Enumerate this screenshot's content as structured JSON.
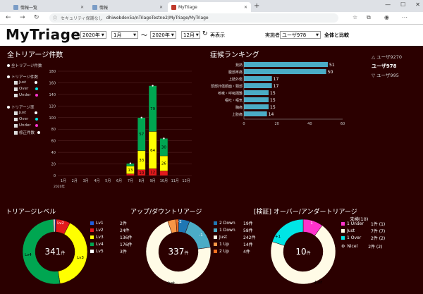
{
  "browser": {
    "tabs": [
      {
        "label": "情報一覧"
      },
      {
        "label": "情報"
      },
      {
        "label": "MyTriage"
      }
    ],
    "new_tab": "+",
    "window_buttons": [
      "—",
      "☐",
      "✕"
    ],
    "url_warning": "セキュリティ保護なし",
    "url_domain": "dhiwebdev5a/nTriageTestne2/MyTriage/MyTriage"
  },
  "header": {
    "title": "MyTriage",
    "from_year": "2020年",
    "from_month": "1月",
    "range_sep": "～",
    "to_year": "2020年",
    "to_month": "12月",
    "refresh_label": "再表示",
    "executor_label": "実施者",
    "executor_value": "ユーザ978",
    "compare_label": "全体と比較"
  },
  "triage_count": {
    "title": "全トリアージ件数",
    "legend": {
      "all": "全トリアージ件数",
      "group1": "トリアージ件数",
      "group1_items": [
        "Just",
        "Over",
        "Under"
      ],
      "group2": "トリアージ率",
      "group2_items": [
        "Just",
        "Over",
        "Under",
        "修正件数"
      ]
    },
    "y_ticks": [
      "180",
      "160",
      "140",
      "120",
      "100",
      "80",
      "60",
      "40",
      "20",
      "0"
    ],
    "x_labels": [
      "1月",
      "2月",
      "3月",
      "4月",
      "5月",
      "6月",
      "7月",
      "8月",
      "9月",
      "10月",
      "11月",
      "12月"
    ],
    "x_year": "2020年"
  },
  "chart_data": {
    "type": "bar",
    "categories": [
      "1月",
      "2月",
      "3月",
      "4月",
      "5月",
      "6月",
      "7月",
      "8月",
      "9月",
      "10月",
      "11月",
      "12月"
    ],
    "ylim": [
      0,
      180
    ],
    "series": [
      {
        "name": "Lv5",
        "color": "#ffffff",
        "values": [
          0,
          0,
          0,
          0,
          0,
          0,
          0,
          0,
          0,
          0,
          0,
          0
        ]
      },
      {
        "name": "Lv4",
        "color": "#00a651",
        "values": [
          0,
          0,
          0,
          0,
          0,
          0,
          5,
          57,
          79,
          30,
          0,
          0
        ]
      },
      {
        "name": "Lv3",
        "color": "#ffff00",
        "values": [
          0,
          0,
          0,
          0,
          0,
          0,
          13,
          33,
          64,
          26,
          0,
          0
        ]
      },
      {
        "name": "Lv2",
        "color": "#e31a1c",
        "values": [
          0,
          0,
          0,
          0,
          0,
          0,
          3,
          10,
          12,
          8,
          0,
          0
        ]
      }
    ],
    "totals": [
      0,
      0,
      0,
      0,
      0,
      0,
      21,
      100,
      155,
      64,
      0,
      0
    ]
  },
  "symptom_ranking": {
    "title": "症候ランキング",
    "items": [
      {
        "label": "発熱",
        "value": 51
      },
      {
        "label": "腹部疼痛",
        "value": 50
      },
      {
        "label": "上肢外傷",
        "value": 17
      },
      {
        "label": "頭部外傷顔面・頚部",
        "value": 17
      },
      {
        "label": "咳嗽・呼吸困難",
        "value": 15
      },
      {
        "label": "嘔吐・嘔気",
        "value": 15
      },
      {
        "label": "胸痛",
        "value": 15
      },
      {
        "label": "上肢痛",
        "value": 14
      }
    ],
    "x_ticks": [
      "0",
      "20",
      "40",
      "60"
    ],
    "max": 60
  },
  "users": {
    "prev": "△ ユーザ9270",
    "current": "ユーザ978",
    "next": "▽ ユーザ995"
  },
  "triage_level": {
    "title": "トリアージレベル",
    "center_value": "341",
    "center_unit": "件",
    "slices": [
      {
        "name": "Lv1",
        "value": 2,
        "count": "2件",
        "color": "#1f5fe0"
      },
      {
        "name": "Lv2",
        "value": 24,
        "count": "24件",
        "color": "#e31a1c"
      },
      {
        "name": "Lv3",
        "value": 136,
        "count": "136件",
        "color": "#ffff00"
      },
      {
        "name": "Lv4",
        "value": 176,
        "count": "176件",
        "color": "#00a651"
      },
      {
        "name": "Lv5",
        "value": 3,
        "count": "3件",
        "color": "#ffffff"
      }
    ],
    "labels": [
      "Lv2",
      "Lv3",
      "Lv4"
    ]
  },
  "up_down": {
    "title": "アップ/ダウントリアージ",
    "center_value": "337",
    "center_unit": "件",
    "slices": [
      {
        "name": "2 Down",
        "value": 19,
        "count": "19件",
        "color": "#1f77b4"
      },
      {
        "name": "1 Down",
        "value": 58,
        "count": "58件",
        "color": "#4bacc6"
      },
      {
        "name": "Just",
        "value": 242,
        "count": "242件",
        "color": "#fffbe6"
      },
      {
        "name": "1 Up",
        "value": 14,
        "count": "14件",
        "color": "#f79646"
      },
      {
        "name": "2 Up",
        "value": 4,
        "count": "4件",
        "color": "#f37021"
      }
    ],
    "labels": [
      "-2",
      "-1",
      "Just"
    ]
  },
  "over_under": {
    "title": "[検証] オーバー/アンダートリアージ",
    "center_value": "10",
    "center_unit": "件",
    "unverified": "未検(10)",
    "slices": [
      {
        "name": "1 Under",
        "value": 1,
        "count": "1件 (1)",
        "color": "#ff33cc"
      },
      {
        "name": "Just",
        "value": 7,
        "count": "7件 (7)",
        "color": "#fffbe6"
      },
      {
        "name": "1 Over",
        "value": 2,
        "count": "2件 (2)",
        "color": "#00e5e5"
      }
    ],
    "labels": [
      "1",
      "Just",
      "+1"
    ],
    "extra_legend": "Nicel",
    "extra_count": "2件 (2)"
  }
}
